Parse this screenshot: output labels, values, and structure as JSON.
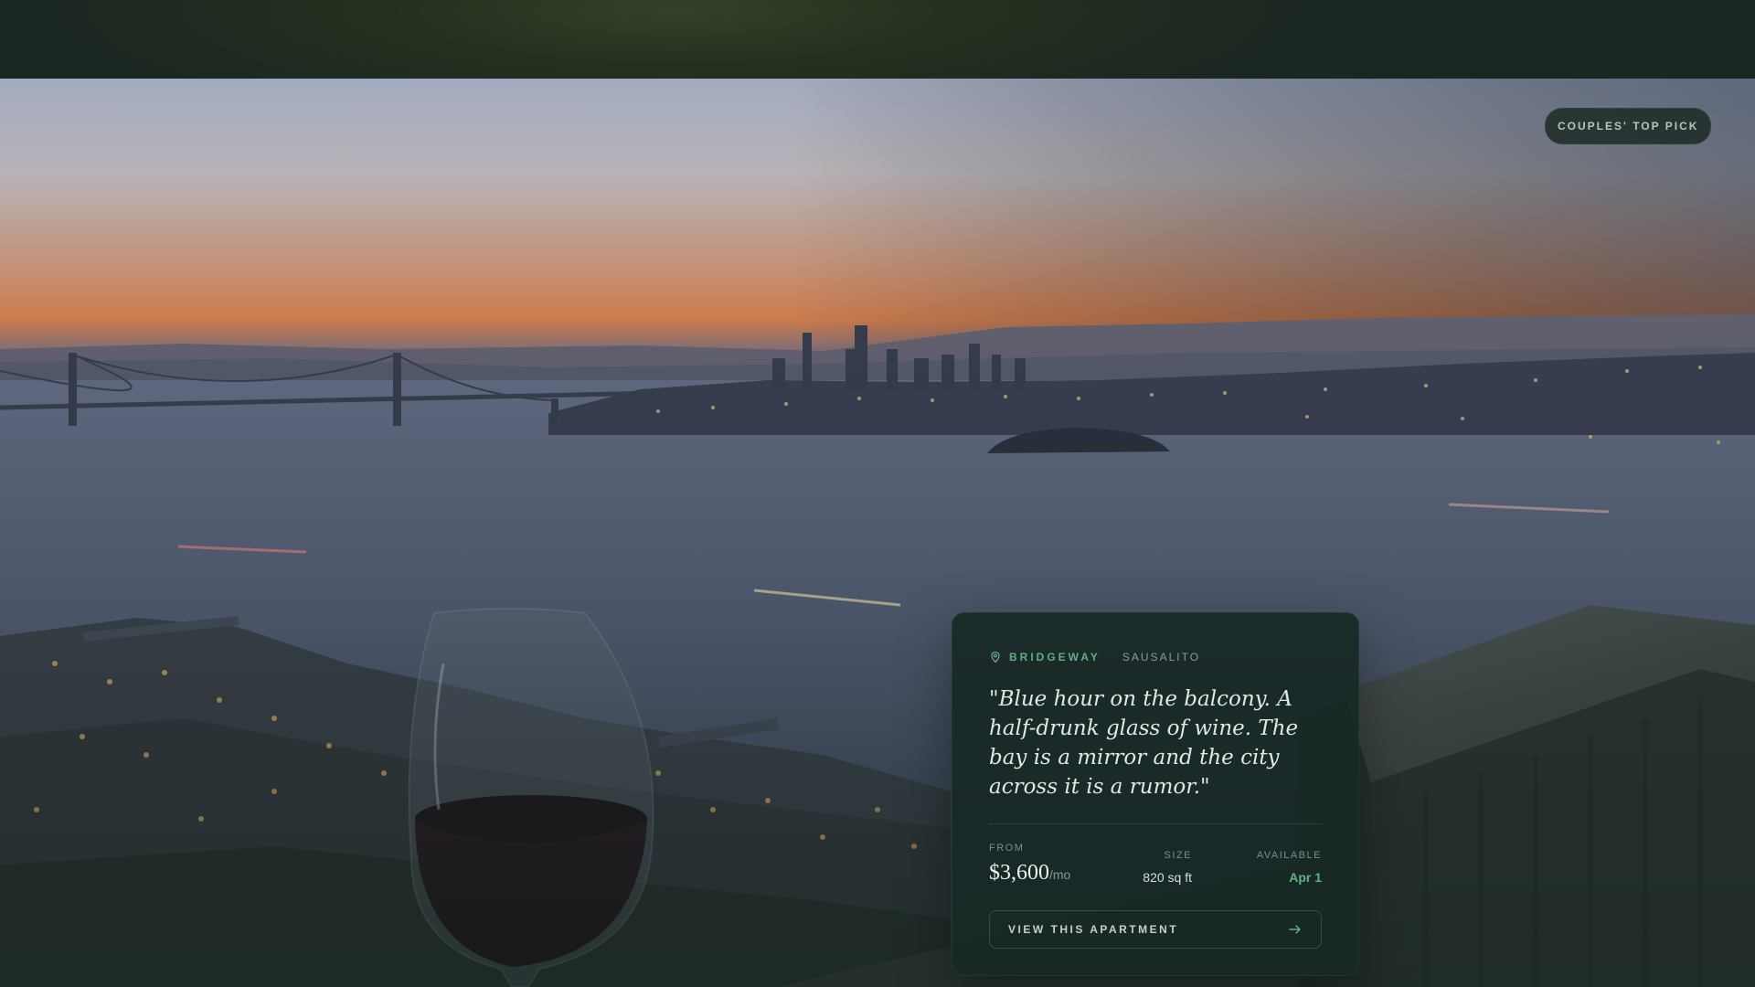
{
  "badge": {
    "label": "COUPLES' TOP PICK"
  },
  "listing": {
    "location_name": "BRIDGEWAY",
    "location_separator": "·",
    "area": "SAUSALITO",
    "quote": "\"Blue hour on the balcony. A half-drunk glass of wine. The bay is a mirror and the city across it is a rumor.\"",
    "from_label": "FROM",
    "price": "$3,600",
    "price_unit": "/mo",
    "size_label": "SIZE",
    "size_value": "820 sq ft",
    "available_label": "AVAILABLE",
    "available_value": "Apr 1",
    "cta_label": "VIEW THIS APARTMENT"
  },
  "icons": {
    "location": "map-pin-icon",
    "cta": "arrow-right-icon"
  },
  "colors": {
    "accent_green": "#5fae86",
    "card_bg": "#182825",
    "header_bg": "#1a2620"
  }
}
